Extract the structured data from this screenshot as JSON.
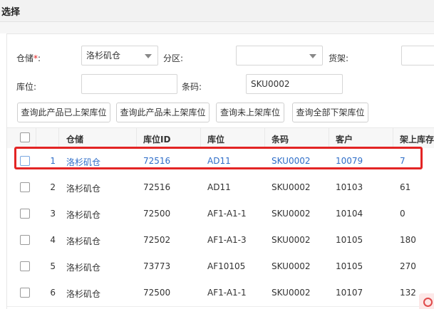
{
  "dialog": {
    "title": "选择"
  },
  "filters": {
    "warehouse_label": "仓储",
    "required_mark": "*",
    "colon": ":",
    "warehouse_value": "洛杉矶仓",
    "zone_label": "分区:",
    "zone_value": "",
    "shelf_label": "货架:",
    "shelf_value": "",
    "location_label": "库位:",
    "location_value": "",
    "barcode_label": "条码:",
    "barcode_value": "SKU0002"
  },
  "buttons": {
    "query_listed": "查询此产品已上架库位",
    "query_unlisted": "查询此产品未上架库位",
    "query_empty": "查询未上架库位",
    "query_all": "查询全部下架库位"
  },
  "table": {
    "columns": [
      "仓储",
      "库位ID",
      "库位",
      "条码",
      "客户",
      "架上库存"
    ],
    "rows": [
      {
        "index": "1",
        "warehouse": "洛杉矶仓",
        "location_id": "72516",
        "location": "AD11",
        "barcode": "SKU0002",
        "customer": "10079",
        "stock": "7"
      },
      {
        "index": "2",
        "warehouse": "洛杉矶仓",
        "location_id": "72516",
        "location": "AD11",
        "barcode": "SKU0002",
        "customer": "10103",
        "stock": "61"
      },
      {
        "index": "3",
        "warehouse": "洛杉矶仓",
        "location_id": "72500",
        "location": "AF1-A1-1",
        "barcode": "SKU0002",
        "customer": "10104",
        "stock": "0"
      },
      {
        "index": "4",
        "warehouse": "洛杉矶仓",
        "location_id": "72502",
        "location": "AF1-A1-3",
        "barcode": "SKU0002",
        "customer": "10105",
        "stock": "180"
      },
      {
        "index": "5",
        "warehouse": "洛杉矶仓",
        "location_id": "73773",
        "location": "AF10105",
        "barcode": "SKU0002",
        "customer": "10105",
        "stock": "270"
      },
      {
        "index": "6",
        "warehouse": "洛杉矶仓",
        "location_id": "72500",
        "location": "AF1-A1-1",
        "barcode": "SKU0002",
        "customer": "10107",
        "stock": "132"
      }
    ]
  },
  "colors": {
    "highlight": "#e32424",
    "selected_text": "#2f6ec8"
  }
}
